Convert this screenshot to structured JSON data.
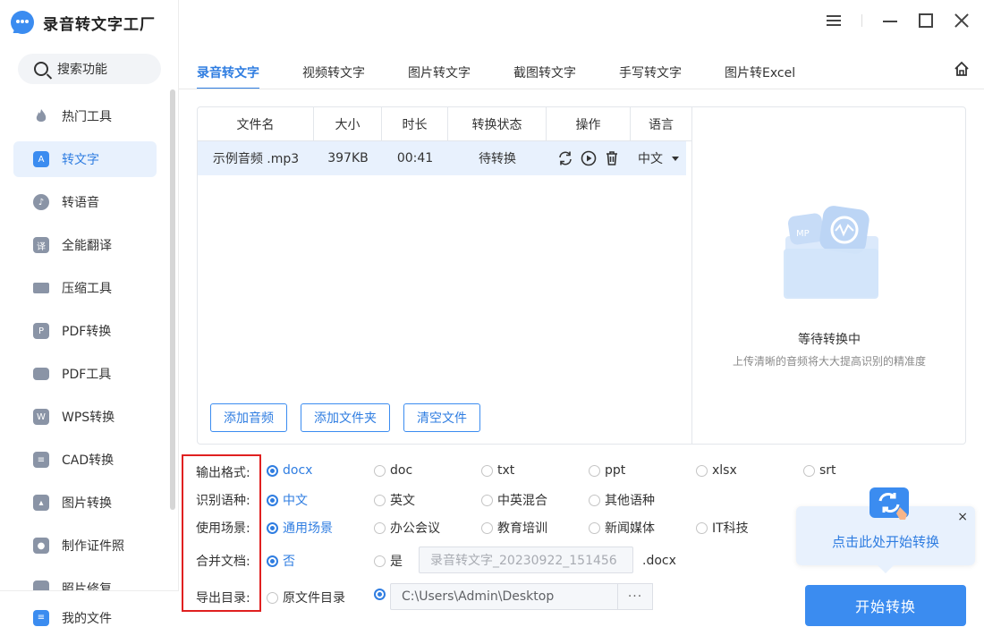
{
  "app": {
    "title": "录音转文字工厂"
  },
  "search": {
    "label": "搜索功能"
  },
  "sidebar": {
    "items": [
      {
        "label": "热门工具",
        "icon": "flame-icon"
      },
      {
        "label": "转文字",
        "icon": "text-convert-icon",
        "active": true
      },
      {
        "label": "转语音",
        "icon": "voice-icon"
      },
      {
        "label": "全能翻译",
        "icon": "translate-icon",
        "glyph": "译"
      },
      {
        "label": "压缩工具",
        "icon": "compress-icon"
      },
      {
        "label": "PDF转换",
        "icon": "pdf-convert-icon",
        "glyph": "P"
      },
      {
        "label": "PDF工具",
        "icon": "toolbox-icon"
      },
      {
        "label": "WPS转换",
        "icon": "wps-icon",
        "glyph": "W"
      },
      {
        "label": "CAD转换",
        "icon": "cad-icon"
      },
      {
        "label": "图片转换",
        "icon": "image-icon"
      },
      {
        "label": "制作证件照",
        "icon": "id-photo-icon"
      },
      {
        "label": "照片修复",
        "icon": "photo-repair-icon"
      }
    ],
    "my_files": "我的文件"
  },
  "tabs": [
    {
      "label": "录音转文字",
      "active": true
    },
    {
      "label": "视频转文字"
    },
    {
      "label": "图片转文字"
    },
    {
      "label": "截图转文字"
    },
    {
      "label": "手写转文字"
    },
    {
      "label": "图片转Excel"
    }
  ],
  "table": {
    "headers": [
      "文件名",
      "大小",
      "时长",
      "转换状态",
      "操作",
      "语言"
    ],
    "rows": [
      {
        "name": "示例音频 .mp3",
        "size": "397KB",
        "duration": "00:41",
        "status": "待转换",
        "language": "中文"
      }
    ]
  },
  "buttons": {
    "add_audio": "添加音频",
    "add_folder": "添加文件夹",
    "clear_files": "清空文件"
  },
  "waiting": {
    "title": "等待转换中",
    "subtitle": "上传清晰的音频将大大提高识别的精准度",
    "illus_text": "MP"
  },
  "options": {
    "output_format": {
      "label": "输出格式:",
      "choices": [
        "docx",
        "doc",
        "txt",
        "ppt",
        "xlsx",
        "srt"
      ],
      "selected": "docx"
    },
    "language": {
      "label": "识别语种:",
      "choices": [
        "中文",
        "英文",
        "中英混合",
        "其他语种"
      ],
      "selected": "中文"
    },
    "scene": {
      "label": "使用场景:",
      "choices": [
        "通用场景",
        "办公会议",
        "教育培训",
        "新闻媒体",
        "IT科技"
      ],
      "selected": "通用场景"
    },
    "merge": {
      "label": "合并文档:",
      "choices": [
        "否",
        "是"
      ],
      "selected": "否",
      "filename_placeholder": "录音转文字_20230922_151456",
      "ext": ".docx"
    },
    "export_dir": {
      "label": "导出目录:",
      "original": "原文件目录",
      "path": "C:\\Users\\Admin\\Desktop",
      "browse": "···"
    }
  },
  "tip": {
    "text": "点击此处开始转换",
    "close": "×"
  },
  "start_button": "开始转换",
  "colors": {
    "accent": "#2f7de1",
    "highlight_box": "#e02020"
  }
}
